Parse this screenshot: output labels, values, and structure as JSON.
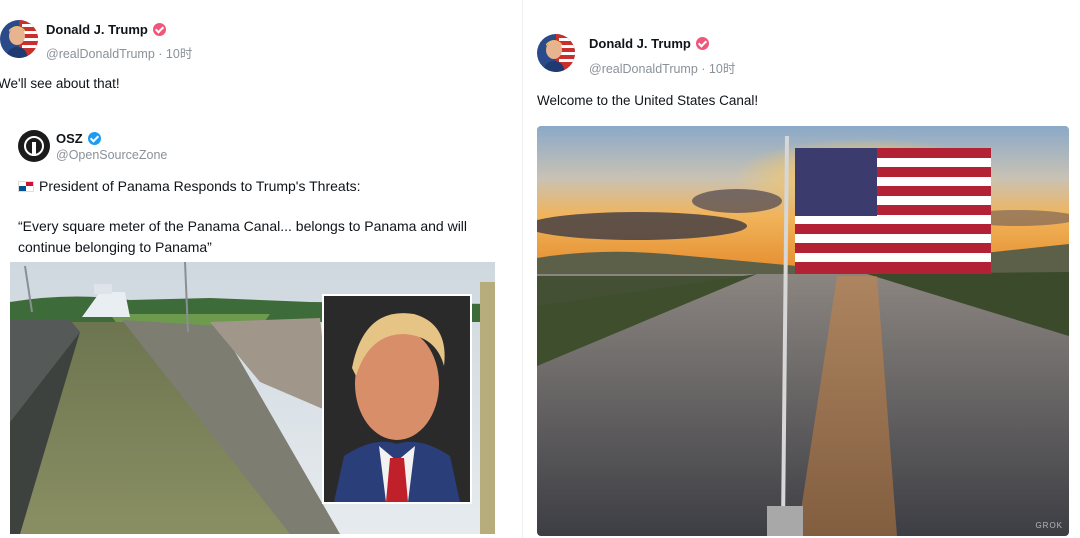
{
  "left_post": {
    "author_name": "Donald J. Trump",
    "handle": "@realDonaldTrump",
    "time": "· 10时",
    "text": "We'll see about that!",
    "quoted": {
      "author_name": "OSZ",
      "handle": "@OpenSourceZone",
      "headline": "President of Panama Responds to Trump's Threats:",
      "quote": "“Every square meter of the Panama Canal... belongs to Panama and will continue belonging to Panama”",
      "image_alt": "Panama Canal locks with cruise ship and inset portrait"
    }
  },
  "right_post": {
    "author_name": "Donald J. Trump",
    "handle": "@realDonaldTrump",
    "time": "· 10时",
    "text": "Welcome to the United States Canal!",
    "image_alt": "American flag over canal at sunset",
    "watermark": "GROK"
  },
  "colors": {
    "verified_trump": "#f0567a",
    "verified_osz": "#1d9bf0",
    "handle_gray": "#8a9199"
  }
}
